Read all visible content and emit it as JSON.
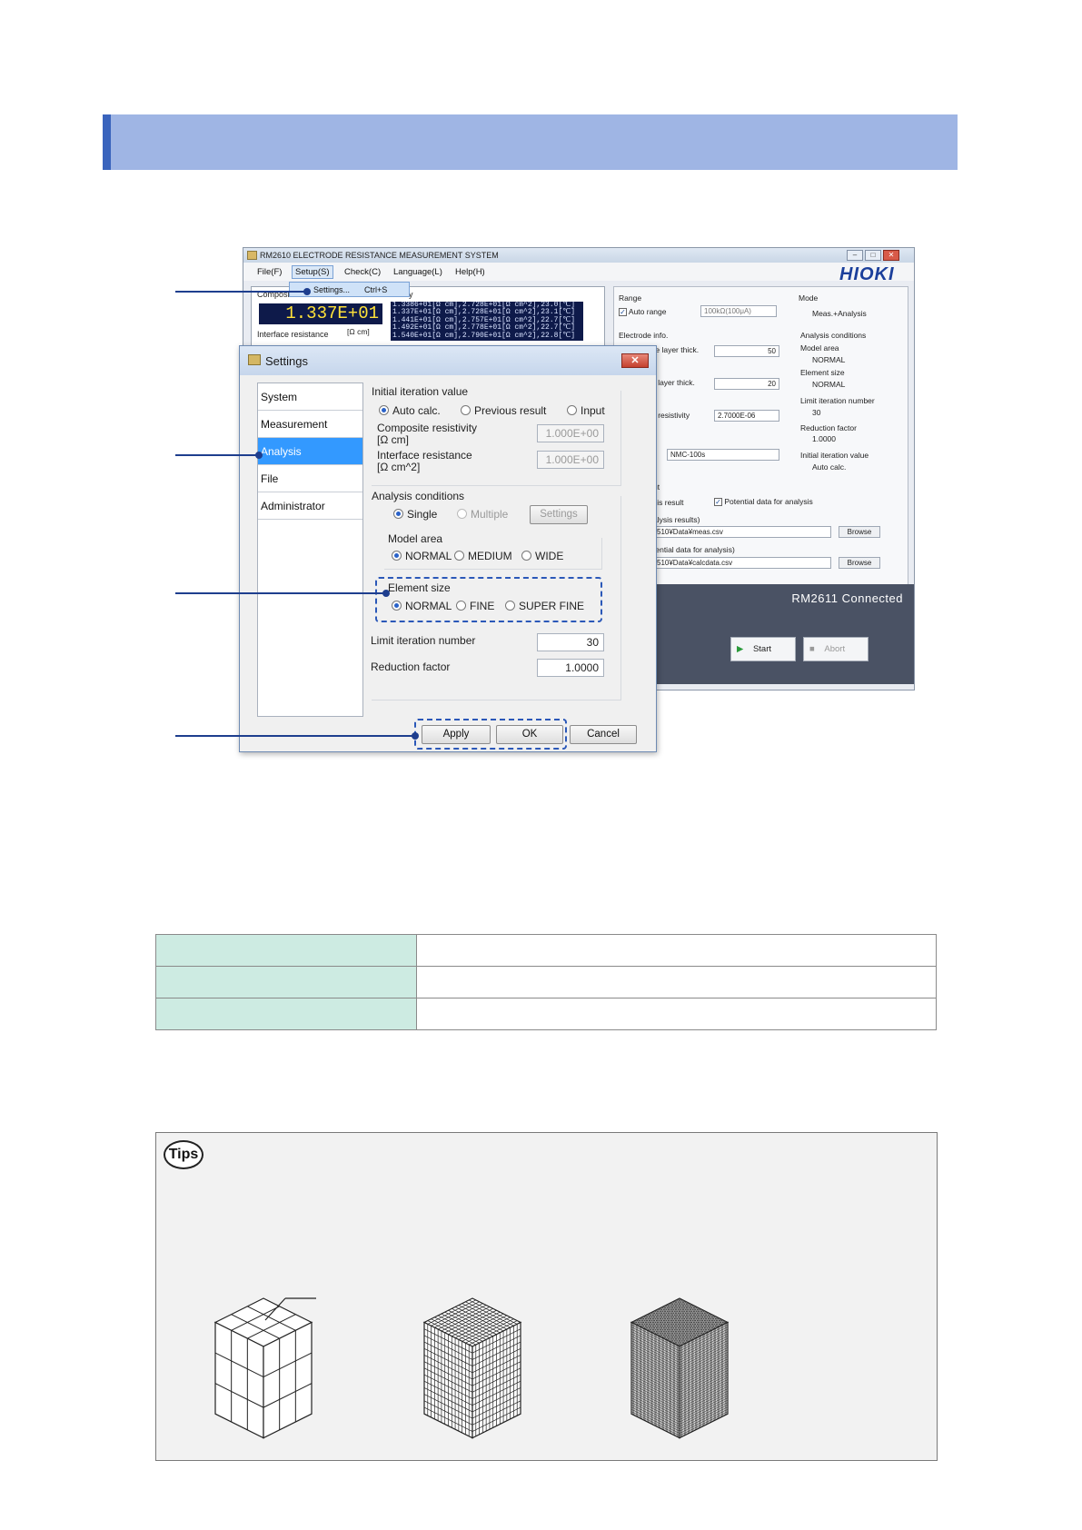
{
  "app": {
    "window_title": "RM2610 ELECTRODE RESISTANCE MEASUREMENT SYSTEM",
    "brand_logo": "HIOKI",
    "menu": [
      "File(F)",
      "Setup(S)",
      "Check(C)",
      "Language(L)",
      "Help(H)"
    ],
    "dropdown_item": "Settings...",
    "dropdown_shortcut": "Ctrl+S",
    "composite_label": "Composi",
    "ry_label": "ry",
    "main_value": "1.337E+01",
    "interface_label": "Interface resistance",
    "interface_unit": "[Ω cm]",
    "log_lines": [
      "1.3386+01[Ω cm],2.728E+01[Ω cm^2],23.0[℃]",
      "1.337E+01[Ω cm],2.728E+01[Ω cm^2],23.1[℃]",
      "1.441E+01[Ω cm],2.757E+01[Ω cm^2],22.7[℃]",
      "1.492E+01[Ω cm],2.778E+01[Ω cm^2],22.7[℃]",
      "1.540E+01[Ω cm],2.790E+01[Ω cm^2],22.8[℃]"
    ],
    "right": {
      "range_label": "Range",
      "auto_range": "Auto range",
      "range_value": "100kΩ(100μA)",
      "mode_label": "Mode",
      "mode_value": "Meas.+Analysis",
      "electrode_info": "Electrode info.",
      "layer_thick_1": "te layer thick.",
      "layer_thick_1_val": "50",
      "layer_thick_2": "r layer thick.",
      "layer_thick_2_val": "20",
      "resistivity": "r resistivity",
      "resistivity_val": "2.7000E-06",
      "t_label": "t",
      "t_val": "NMC-100s",
      "analysis_conditions": "Analysis conditions",
      "model_area": "Model area",
      "model_area_val": "NORMAL",
      "element_size": "Element size",
      "element_size_val": "NORMAL",
      "limit_iter": "Limit iteration number",
      "limit_iter_val": "30",
      "reduction": "Reduction factor",
      "reduction_val": "1.0000",
      "init_iter": "Initial iteration value",
      "init_iter_val": "Auto calc.",
      "ut_label": "ut",
      "sis_result": "sis result",
      "potential_data": "Potential data for analysis",
      "alysis_results": "alysis results)",
      "path_1": "510¥Data¥meas.csv",
      "browse": "Browse",
      "tential_data": "tential data for analysis)",
      "path_2": "510¥Data¥calcdata.csv",
      "status": "RM2611 Connected",
      "start": "Start",
      "abort": "Abort",
      "left_btn_a": "t",
      "left_btn_b": "s"
    }
  },
  "dialog": {
    "title": "Settings",
    "nav": [
      "System",
      "Measurement",
      "Analysis",
      "File",
      "Administrator"
    ],
    "initial_iteration_value": "Initial iteration value",
    "opt_auto": "Auto calc.",
    "opt_previous": "Previous result",
    "opt_input": "Input",
    "composite_resistivity": "Composite resistivity",
    "composite_unit": "[Ω cm]",
    "composite_value": "1.000E+00",
    "interface_resistance": "Interface resistance",
    "interface_unit": "[Ω cm^2]",
    "interface_value": "1.000E+00",
    "analysis_conditions": "Analysis conditions",
    "opt_single": "Single",
    "opt_multiple": "Multiple",
    "settings_btn": "Settings",
    "model_area": "Model area",
    "model_normal": "NORMAL",
    "model_medium": "MEDIUM",
    "model_wide": "WIDE",
    "element_size": "Element size",
    "elem_normal": "NORMAL",
    "elem_fine": "FINE",
    "elem_superfine": "SUPER FINE",
    "limit_iteration": "Limit iteration number",
    "limit_iteration_value": "30",
    "reduction_factor": "Reduction factor",
    "reduction_factor_value": "1.0000",
    "apply": "Apply",
    "ok": "OK",
    "cancel": "Cancel"
  },
  "table": {
    "rows": [
      [
        "",
        ""
      ],
      [
        "",
        ""
      ],
      [
        "",
        ""
      ]
    ]
  },
  "tips": {
    "badge": "Tips"
  },
  "colors": {
    "title_bar": "#9fb5e4",
    "title_accent": "#3a64bd",
    "callout": "#1e3e8e",
    "table_key_bg": "#cdebe2",
    "selection": "#3399ff"
  }
}
